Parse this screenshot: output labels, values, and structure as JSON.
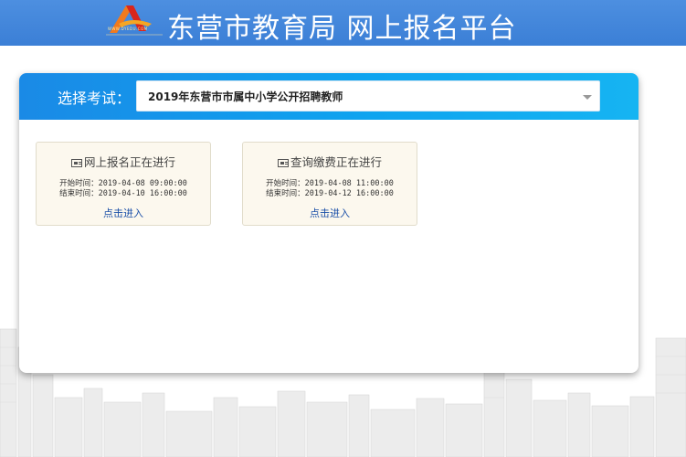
{
  "header": {
    "title": "东营市教育局 网上报名平台",
    "logo_caption": "WWW.DYEDU.COM",
    "colors": {
      "bar": "#3b7fd6",
      "logo_orange": "#f07a1e",
      "logo_red": "#d9261c"
    }
  },
  "exam_selector": {
    "label": "选择考试：",
    "selected": "2019年东营市市属中小学公开招聘教师"
  },
  "cards": [
    {
      "icon": "card-icon",
      "title": "网上报名正在进行",
      "start": "开始时间：2019-04-08 09:00:00",
      "end": "结束时间：2019-04-10 16:00:00",
      "link": "点击进入"
    },
    {
      "icon": "card-icon",
      "title": "查询缴费正在进行",
      "start": "开始时间：2019-04-08 11:00:00",
      "end": "结束时间：2019-04-12 16:00:00",
      "link": "点击进入"
    }
  ]
}
